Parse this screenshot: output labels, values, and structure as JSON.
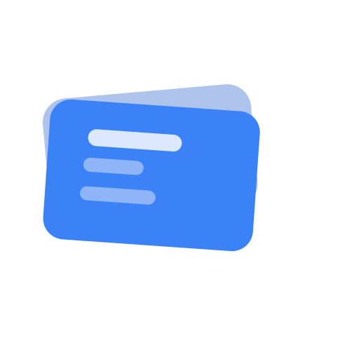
{
  "icon": {
    "name": "cards-stack-icon",
    "colors": {
      "back_card": "#aec4ec",
      "front_card": "#3b82f6",
      "line_primary": "#dbe8fd",
      "line_secondary": "#8fb4f8",
      "background": "#ffffff"
    }
  }
}
